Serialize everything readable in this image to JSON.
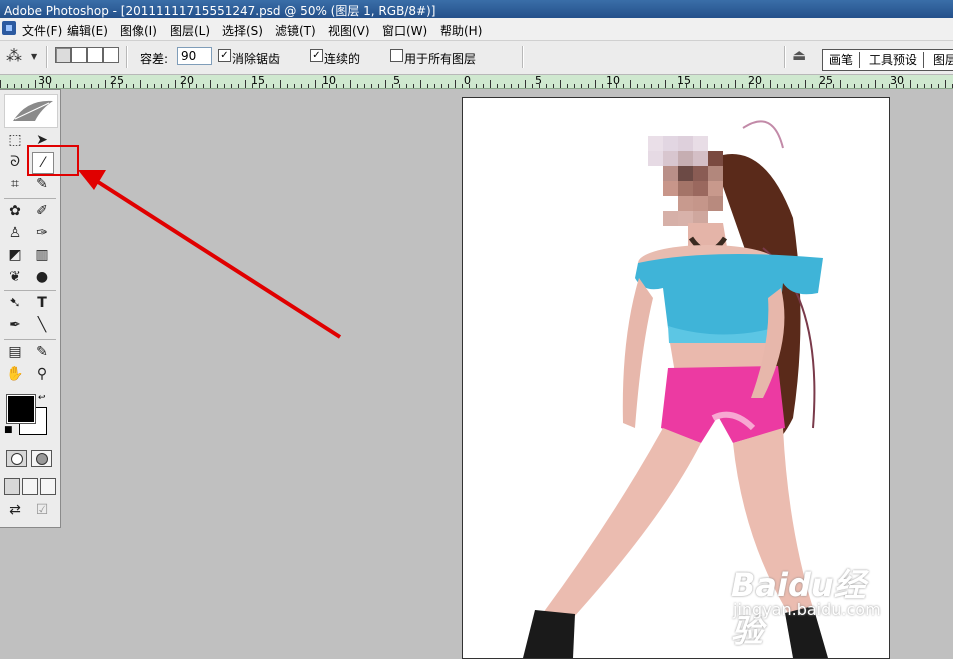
{
  "window": {
    "title": "Adobe Photoshop - [20111111715551247.psd @ 50% (图层 1, RGB/8#)]"
  },
  "menu": {
    "items": [
      "文件(F)",
      "编辑(E)",
      "图像(I)",
      "图层(L)",
      "选择(S)",
      "滤镜(T)",
      "视图(V)",
      "窗口(W)",
      "帮助(H)"
    ]
  },
  "options": {
    "tolerance_label": "容差:",
    "tolerance_value": "90",
    "anti_alias_label": "消除锯齿",
    "contiguous_label": "连续的",
    "all_layers_label": "用于所有图层",
    "palette_tabs": [
      "画笔",
      "工具预设",
      "图层"
    ]
  },
  "ruler": {
    "labels": [
      "30",
      "25",
      "20",
      "15",
      "10",
      "5",
      "0",
      "5",
      "10",
      "15",
      "20",
      "25",
      "30"
    ]
  },
  "toolbox": {
    "tools": [
      "marquee-icon",
      "move-icon",
      "lasso-icon",
      "magic-wand-icon",
      "crop-icon",
      "slice-icon",
      "healing-brush-icon",
      "brush-icon",
      "clone-stamp-icon",
      "history-brush-icon",
      "eraser-icon",
      "gradient-icon",
      "blur-icon",
      "dodge-icon",
      "path-selection-icon",
      "type-icon",
      "pen-icon",
      "line-icon",
      "notes-icon",
      "eyedropper-icon",
      "hand-icon",
      "zoom-icon"
    ]
  },
  "annotation": {
    "highlight_color": "#e00000",
    "arrow_color": "#e00000"
  },
  "watermark": {
    "logo": "Baidu经验",
    "url": "jingyan.baidu.com"
  }
}
